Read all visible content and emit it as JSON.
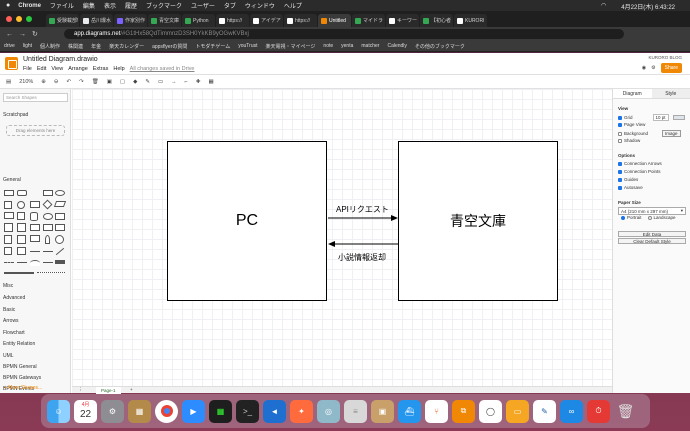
{
  "macos": {
    "menu": [
      "Chrome",
      "ファイル",
      "編集",
      "表示",
      "履歴",
      "ブックマーク",
      "ユーザー",
      "タブ",
      "ウィンドウ",
      "ヘルプ"
    ],
    "clock": "4月22日(木) 6:43:22"
  },
  "browser": {
    "tabs": [
      {
        "label": "受験載部!",
        "color": "#34a853",
        "active": false
      },
      {
        "label": "岳川爆水",
        "color": "#e8eaed",
        "active": false
      },
      {
        "label": "作家別作",
        "color": "#7b61ff",
        "active": false
      },
      {
        "label": "青空文庫",
        "color": "#34a853",
        "active": false
      },
      {
        "label": "Python",
        "color": "#34a853",
        "active": false
      },
      {
        "label": "https://",
        "color": "#ffffff",
        "active": false
      },
      {
        "label": "アイデア",
        "color": "#ffffff",
        "active": false
      },
      {
        "label": "https://",
        "color": "#ffffff",
        "active": false
      },
      {
        "label": "Untitled",
        "color": "#f08705",
        "active": true
      },
      {
        "label": "マイドラ",
        "color": "#34a853",
        "active": false
      },
      {
        "label": "キーワー",
        "color": "#ffffff",
        "active": false
      },
      {
        "label": "【初心者",
        "color": "#34a853",
        "active": false
      },
      {
        "label": "KURORI",
        "color": "#ffffff",
        "active": false
      }
    ],
    "url_host": "app.diagrams.net",
    "url_rest": "/#G1tHx58QdTimmnzD3SH0YkKB9yOGwKVBxj",
    "bookmarks": [
      "drive",
      "light",
      "個人制作",
      "株関連",
      "年金",
      "楽天カレンダー",
      "appsflyerの質問",
      "トモダチゲーム",
      "youTrust",
      "楽天電視・マイページ",
      "note",
      "yenta",
      "matcher",
      "Calendly",
      "その他のブックマーク"
    ]
  },
  "drawio": {
    "title": "Untitled Diagram.drawio",
    "menus": [
      "File",
      "Edit",
      "View",
      "Arrange",
      "Extras",
      "Help"
    ],
    "saved": "All changes saved in Drive",
    "account": "KURORO BLOG",
    "share": "Share",
    "zoom": "210%",
    "search_placeholder": "Search Shapes",
    "scratchpad": "Scratchpad",
    "drag_hint": "Drag elements here",
    "general": "General",
    "libraries": [
      "Misc",
      "Advanced",
      "Basic",
      "Arrows",
      "Flowchart",
      "Entity Relation",
      "UML",
      "BPMN General",
      "BPMN Gateways",
      "BPMN Events"
    ],
    "more_shapes": "+ More Shapes...",
    "page_tab": "Page-1",
    "panel_tabs": [
      "Diagram",
      "Style"
    ],
    "view_label": "View",
    "view_items": [
      {
        "label": "Grid",
        "checked": true
      },
      {
        "label": "Page View",
        "checked": true
      },
      {
        "label": "Background",
        "checked": false
      },
      {
        "label": "Shadow",
        "checked": false
      }
    ],
    "grid_size": "10 pt",
    "image_btn": "Image",
    "options_label": "Options",
    "options_items": [
      {
        "label": "Connection Arrows",
        "checked": true
      },
      {
        "label": "Connection Points",
        "checked": true
      },
      {
        "label": "Guides",
        "checked": true
      },
      {
        "label": "Autosave",
        "checked": true
      }
    ],
    "paper_label": "Paper Size",
    "paper_value": "A4 (210 mm x 297 mm)",
    "portrait": "Portrait",
    "landscape": "Landscape",
    "edit_data": "Edit Data",
    "clear_style": "Clear Default Style"
  },
  "diagram": {
    "left_box": "PC",
    "right_box": "青空文庫",
    "arrow_top": "APIリクエスト",
    "arrow_bottom": "小説情報返却"
  },
  "dock": {
    "calendar_month": "4月",
    "calendar_day": "22"
  }
}
